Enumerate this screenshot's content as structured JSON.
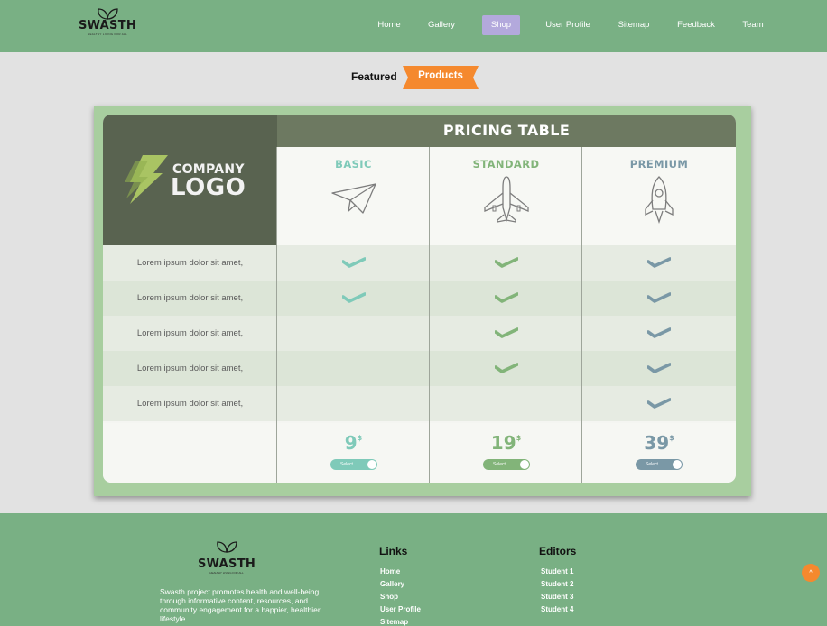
{
  "header": {
    "brand": "SWASTH",
    "tagline": "HEALTHY LIVING FOR ALL",
    "nav": [
      {
        "label": "Home"
      },
      {
        "label": "Gallery"
      },
      {
        "label": "Shop"
      },
      {
        "label": "User Profile"
      },
      {
        "label": "Sitemap"
      },
      {
        "label": "Feedback"
      },
      {
        "label": "Team"
      }
    ],
    "active_nav": "Shop",
    "colors": {
      "bar": "#79b084",
      "active": "#b3a9dc"
    }
  },
  "section": {
    "title_prefix": "Featured",
    "title_highlight": "Products",
    "ribbon_color": "#f5892e"
  },
  "pricing": {
    "title": "PRICING TABLE",
    "logo_line1": "COMPANY",
    "logo_line2": "LOGO",
    "plans": [
      {
        "name": "BASIC",
        "price": "9",
        "currency": "$",
        "button": "Select",
        "color": "#7fcab9",
        "icon": "paper-plane-icon"
      },
      {
        "name": "STANDARD",
        "price": "19",
        "currency": "$",
        "button": "Select",
        "color": "#82b479",
        "icon": "airplane-icon"
      },
      {
        "name": "PREMIUM",
        "price": "39",
        "currency": "$",
        "button": "Select",
        "color": "#7a98a6",
        "icon": "rocket-icon"
      }
    ],
    "features": [
      {
        "label": "Lorem ipsum dolor sit amet,",
        "checks": [
          true,
          true,
          true
        ]
      },
      {
        "label": "Lorem ipsum dolor sit amet,",
        "checks": [
          true,
          true,
          true
        ]
      },
      {
        "label": "Lorem ipsum dolor sit amet,",
        "checks": [
          false,
          true,
          true
        ]
      },
      {
        "label": "Lorem ipsum dolor sit amet,",
        "checks": [
          false,
          true,
          true
        ]
      },
      {
        "label": "Lorem ipsum dolor sit amet,",
        "checks": [
          false,
          false,
          true
        ]
      }
    ]
  },
  "footer": {
    "brand": "SWASTH",
    "tagline": "HEALTHY LIVING FOR ALL",
    "description": "Swasth project promotes health and well-being through informative content, resources, and community engagement for a happier, healthier lifestyle.",
    "links_heading": "Links",
    "links": [
      "Home",
      "Gallery",
      "Shop",
      "User Profile",
      "Sitemap"
    ],
    "editors_heading": "Editors",
    "editors": [
      "Student 1",
      "Student 2",
      "Student 3",
      "Student 4"
    ],
    "back_to_top": "^"
  }
}
